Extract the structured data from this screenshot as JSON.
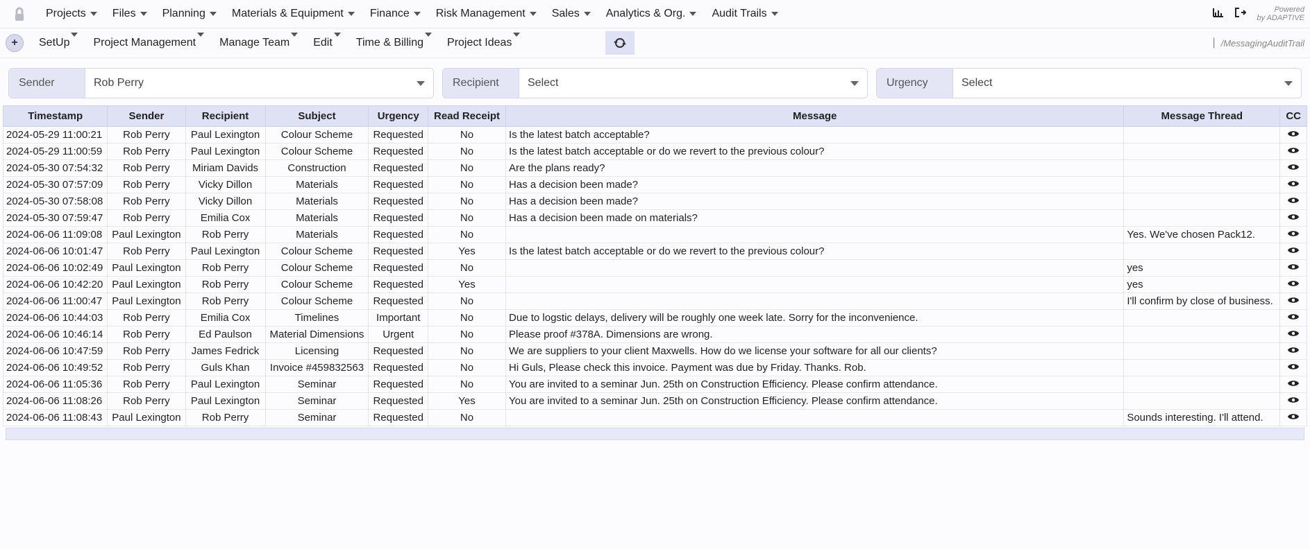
{
  "topnav": {
    "items": [
      "Projects",
      "Files",
      "Planning",
      "Materials & Equipment",
      "Finance",
      "Risk Management",
      "Sales",
      "Analytics & Org.",
      "Audit Trails"
    ],
    "powered_line1": "Powered",
    "powered_line2": "by ADAPTIVE"
  },
  "secondnav": {
    "items": [
      "SetUp",
      "Project Management",
      "Manage Team",
      "Edit",
      "Time & Billing",
      "Project Ideas"
    ],
    "breadcrumb": "/MessagingAuditTrail"
  },
  "filters": {
    "sender_label": "Sender",
    "sender_value": "Rob Perry",
    "recipient_label": "Recipient",
    "recipient_value": "Select",
    "urgency_label": "Urgency",
    "urgency_value": "Select"
  },
  "columns": [
    "Timestamp",
    "Sender",
    "Recipient",
    "Subject",
    "Urgency",
    "Read Receipt",
    "Message",
    "Message Thread",
    "CC"
  ],
  "rows": [
    {
      "ts": "2024-05-29 11:00:21",
      "sender": "Rob Perry",
      "recip": "Paul Lexington",
      "subj": "Colour Scheme",
      "urg": "Requested",
      "read": "No",
      "msg": "Is the latest batch acceptable?",
      "thread": ""
    },
    {
      "ts": "2024-05-29 11:00:59",
      "sender": "Rob Perry",
      "recip": "Paul Lexington",
      "subj": "Colour Scheme",
      "urg": "Requested",
      "read": "No",
      "msg": "Is the latest batch acceptable or do we revert to the previous colour?",
      "thread": ""
    },
    {
      "ts": "2024-05-30 07:54:32",
      "sender": "Rob Perry",
      "recip": "Miriam Davids",
      "subj": "Construction",
      "urg": "Requested",
      "read": "No",
      "msg": "Are the plans ready?",
      "thread": ""
    },
    {
      "ts": "2024-05-30 07:57:09",
      "sender": "Rob Perry",
      "recip": "Vicky Dillon",
      "subj": "Materials",
      "urg": "Requested",
      "read": "No",
      "msg": "Has a decision been made?",
      "thread": ""
    },
    {
      "ts": "2024-05-30 07:58:08",
      "sender": "Rob Perry",
      "recip": "Vicky Dillon",
      "subj": "Materials",
      "urg": "Requested",
      "read": "No",
      "msg": "Has a decision been made?",
      "thread": ""
    },
    {
      "ts": "2024-05-30 07:59:47",
      "sender": "Rob Perry",
      "recip": "Emilia Cox",
      "subj": "Materials",
      "urg": "Requested",
      "read": "No",
      "msg": "Has a decision been made on materials?",
      "thread": ""
    },
    {
      "ts": "2024-06-06 11:09:08",
      "sender": "Paul Lexington",
      "recip": "Rob Perry",
      "subj": "Materials",
      "urg": "Requested",
      "read": "No",
      "msg": "",
      "thread": "Yes. We've chosen Pack12."
    },
    {
      "ts": "2024-06-06 10:01:47",
      "sender": "Rob Perry",
      "recip": "Paul Lexington",
      "subj": "Colour Scheme",
      "urg": "Requested",
      "read": "Yes",
      "msg": "Is the latest batch acceptable or do we revert to the previous colour?",
      "thread": ""
    },
    {
      "ts": "2024-06-06 10:02:49",
      "sender": "Paul Lexington",
      "recip": "Rob Perry",
      "subj": "Colour Scheme",
      "urg": "Requested",
      "read": "No",
      "msg": "",
      "thread": "yes"
    },
    {
      "ts": "2024-06-06 10:42:20",
      "sender": "Paul Lexington",
      "recip": "Rob Perry",
      "subj": "Colour Scheme",
      "urg": "Requested",
      "read": "Yes",
      "msg": "",
      "thread": "yes"
    },
    {
      "ts": "2024-06-06 11:00:47",
      "sender": "Paul Lexington",
      "recip": "Rob Perry",
      "subj": "Colour Scheme",
      "urg": "Requested",
      "read": "No",
      "msg": "",
      "thread": "I'll confirm by close of business."
    },
    {
      "ts": "2024-06-06 10:44:03",
      "sender": "Rob Perry",
      "recip": "Emilia Cox",
      "subj": "Timelines",
      "urg": "Important",
      "read": "No",
      "msg": "Due to logstic delays, delivery will be roughly one week late. Sorry for the inconvenience.",
      "thread": ""
    },
    {
      "ts": "2024-06-06 10:46:14",
      "sender": "Rob Perry",
      "recip": "Ed Paulson",
      "subj": "Material Dimensions",
      "urg": "Urgent",
      "read": "No",
      "msg": "Please proof #378A. Dimensions are wrong.",
      "thread": ""
    },
    {
      "ts": "2024-06-06 10:47:59",
      "sender": "Rob Perry",
      "recip": "James Fedrick",
      "subj": "Licensing",
      "urg": "Requested",
      "read": "No",
      "msg": "We are suppliers to your client Maxwells. How do we license your software for all our clients?",
      "thread": ""
    },
    {
      "ts": "2024-06-06 10:49:52",
      "sender": "Rob Perry",
      "recip": "Guls Khan",
      "subj": "Invoice #459832563",
      "urg": "Requested",
      "read": "No",
      "msg": "Hi Guls, Please check this invoice. Payment was due by Friday. Thanks. Rob.",
      "thread": ""
    },
    {
      "ts": "2024-06-06 11:05:36",
      "sender": "Rob Perry",
      "recip": "Paul Lexington",
      "subj": "Seminar",
      "urg": "Requested",
      "read": "No",
      "msg": "You are invited to a seminar Jun. 25th on Construction Efficiency. Please confirm attendance.",
      "thread": ""
    },
    {
      "ts": "2024-06-06 11:08:26",
      "sender": "Rob Perry",
      "recip": "Paul Lexington",
      "subj": "Seminar",
      "urg": "Requested",
      "read": "Yes",
      "msg": "You are invited to a seminar Jun. 25th on Construction Efficiency. Please confirm attendance.",
      "thread": ""
    },
    {
      "ts": "2024-06-06 11:08:43",
      "sender": "Paul Lexington",
      "recip": "Rob Perry",
      "subj": "Seminar",
      "urg": "Requested",
      "read": "No",
      "msg": "",
      "thread": "Sounds interesting. I'll attend."
    }
  ]
}
